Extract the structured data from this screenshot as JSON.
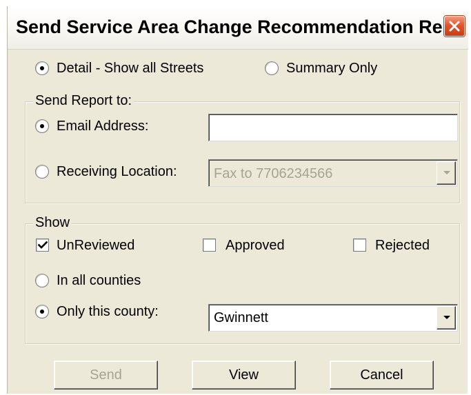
{
  "window": {
    "title": "Send Service Area Change Recommendation Re..."
  },
  "detail_options": {
    "detail_label": "Detail - Show all Streets",
    "detail_selected": true,
    "summary_label": "Summary Only",
    "summary_selected": false
  },
  "send_report": {
    "group_label": "Send Report to:",
    "email_label": "Email Address:",
    "email_selected": true,
    "email_value": "",
    "receiving_label": "Receiving Location:",
    "receiving_selected": false,
    "receiving_value": "Fax to 7706234566"
  },
  "show": {
    "group_label": "Show",
    "unreviewed_label": "UnReviewed",
    "unreviewed_checked": true,
    "approved_label": "Approved",
    "approved_checked": false,
    "rejected_label": "Rejected",
    "rejected_checked": false,
    "all_counties_label": "In all counties",
    "all_counties_selected": false,
    "only_county_label": "Only this county:",
    "only_county_selected": true,
    "county_value": "Gwinnett"
  },
  "buttons": {
    "send_label": "Send",
    "view_label": "View",
    "cancel_label": "Cancel"
  },
  "colors": {
    "dialog_bg": "#ece9d8",
    "close_button": "#e2542d",
    "disabled_text": "#a6a394"
  }
}
